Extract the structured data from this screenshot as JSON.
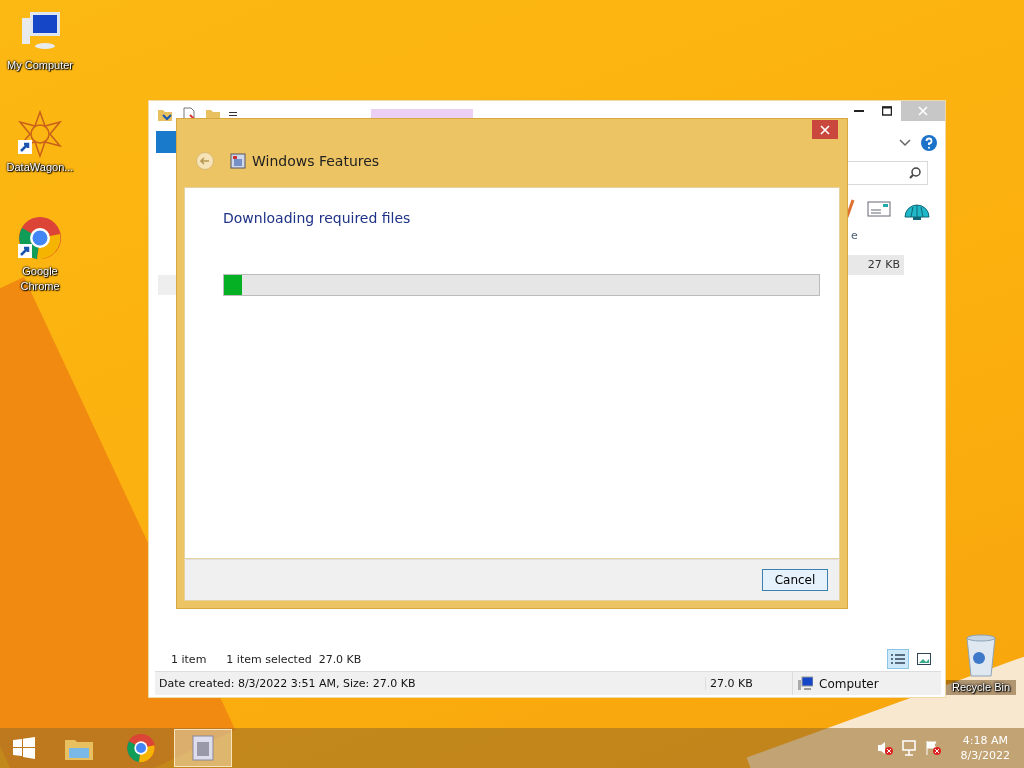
{
  "desktop_icons": [
    {
      "kind": "computer",
      "label": "My Computer"
    },
    {
      "kind": "star",
      "label": "DataWagon..."
    },
    {
      "kind": "chrome",
      "label": "Google Chrome"
    },
    {
      "kind": "bin",
      "label": "Recycle Bin"
    }
  ],
  "explorer": {
    "column_3": "e",
    "cell": "27 KB",
    "item_count": "1 item",
    "selection": "1 item selected  27.0 KB",
    "details": "Date created: 8/3/2022 3:51 AM, Size: 27.0 KB",
    "details_size": "27.0 KB",
    "location": "Computer"
  },
  "dialog": {
    "title": "Windows Features",
    "heading": "Downloading required files",
    "progress": {
      "level": 0.03
    },
    "buttons": [
      "Cancel"
    ]
  },
  "taskbar": {
    "apps": [
      {
        "kind": "explorer",
        "selected": false
      },
      {
        "kind": "chrome",
        "selected": false
      },
      {
        "kind": "features",
        "selected": true
      }
    ],
    "time": "4:18 AM",
    "date": "8/3/2022"
  }
}
